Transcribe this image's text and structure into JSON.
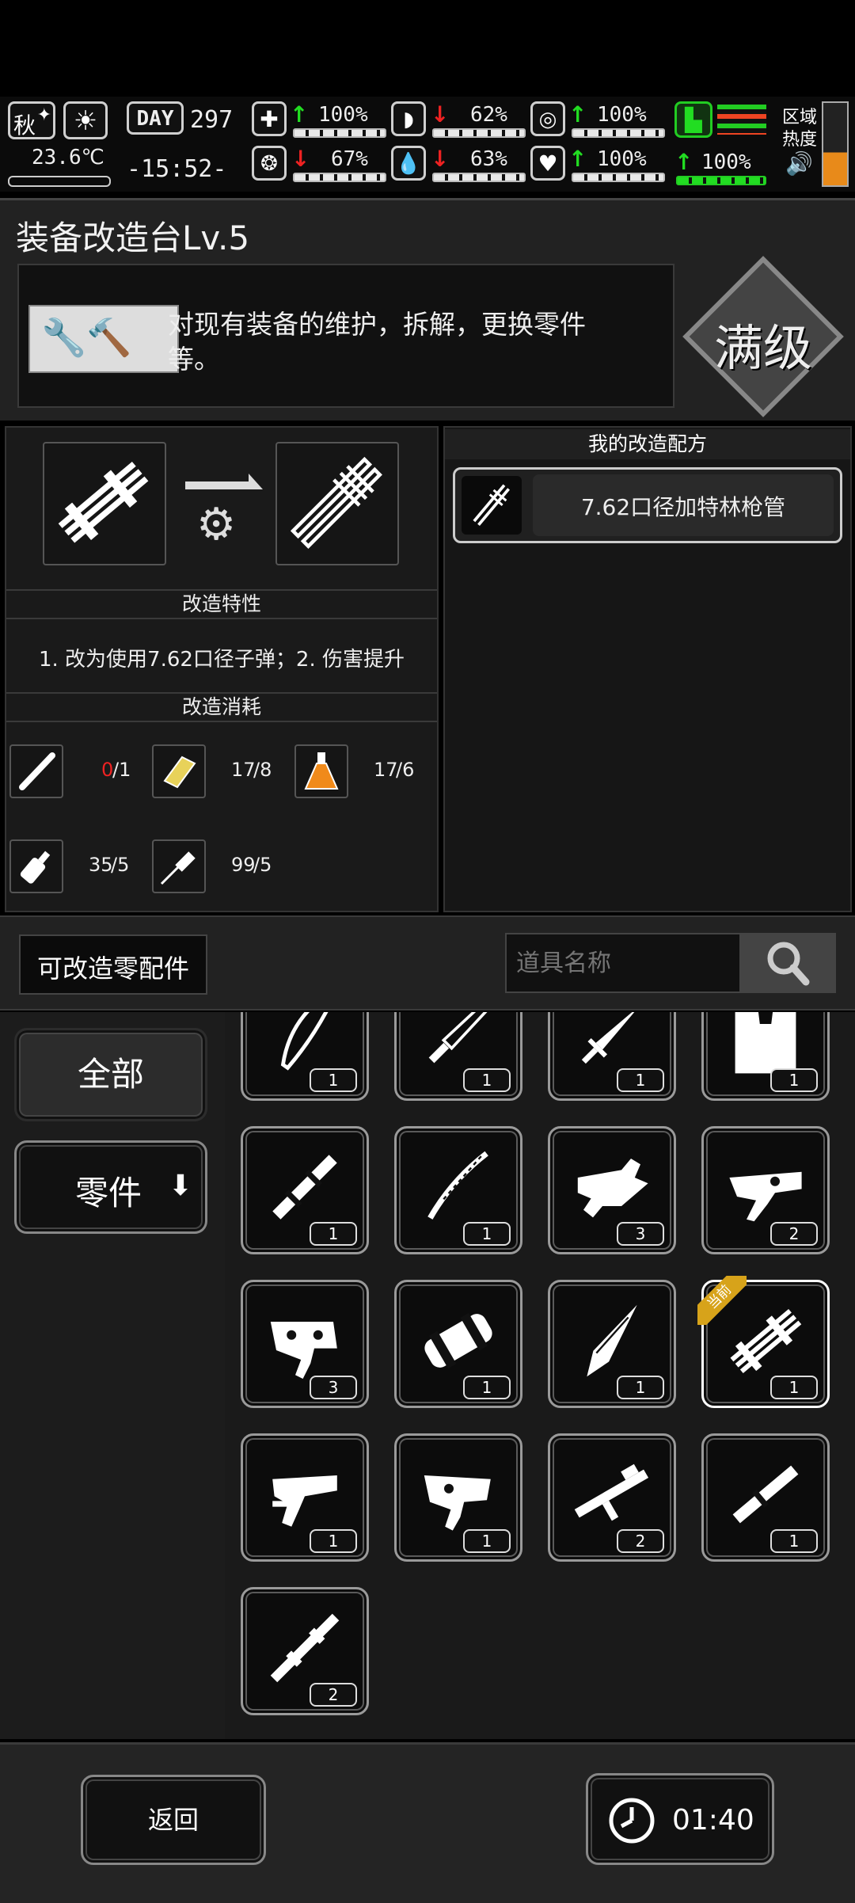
{
  "hud": {
    "season": "秋",
    "temperature": "23.6℃",
    "day_label": "DAY",
    "day_number": "297",
    "clock": "-15:52-",
    "stats": [
      {
        "id": "health",
        "dir": "up",
        "value": "100%"
      },
      {
        "id": "hunger",
        "dir": "down",
        "value": "62%"
      },
      {
        "id": "armor",
        "dir": "up",
        "value": "100%"
      },
      {
        "id": "sanity",
        "dir": "down",
        "value": "67%"
      },
      {
        "id": "thirst",
        "dir": "down",
        "value": "63%"
      },
      {
        "id": "heart",
        "dir": "up",
        "value": "100%"
      },
      {
        "id": "stamina",
        "dir": "up",
        "value": "100%"
      }
    ],
    "zone_heat_label_1": "区域",
    "zone_heat_label_2": "热度"
  },
  "station": {
    "title": "装备改造台Lv.5",
    "description_line1": "对现有装备的维护，拆解，更换零件",
    "description_line2": "等。",
    "max_level_badge": "满级"
  },
  "modify": {
    "traits_header": "改造特性",
    "traits_text": "1. 改为使用7.62口径子弹；2. 伤害提升",
    "cost_header": "改造消耗",
    "costs": [
      {
        "icon": "pipe-icon",
        "have": "0",
        "need": "/1",
        "short": true
      },
      {
        "icon": "gold-bar-icon",
        "have": "17",
        "need": "/8",
        "short": false
      },
      {
        "icon": "potion-flask-icon",
        "have": "17",
        "need": "/6",
        "short": false
      },
      {
        "icon": "oil-can-icon",
        "have": "35",
        "need": "/5",
        "short": false
      },
      {
        "icon": "screwdriver-icon",
        "have": "99",
        "need": "/5",
        "short": false
      }
    ]
  },
  "recipes": {
    "header": "我的改造配方",
    "items": [
      {
        "label": "7.62口径加特林枪管"
      }
    ]
  },
  "parts_bar": {
    "title": "可改造零配件",
    "search_placeholder": "道具名称"
  },
  "categories": [
    {
      "label": "全部"
    },
    {
      "label": "零件"
    }
  ],
  "current_tag": "当前",
  "grid": [
    {
      "icon": "machete-icon",
      "count": "1"
    },
    {
      "icon": "combat-knife-icon",
      "count": "1"
    },
    {
      "icon": "sword-icon",
      "count": "1"
    },
    {
      "icon": "vest-icon",
      "count": "1"
    },
    {
      "icon": "barrel-icon",
      "count": "1"
    },
    {
      "icon": "katana-icon",
      "count": "1"
    },
    {
      "icon": "receiver-icon",
      "count": "3"
    },
    {
      "icon": "trigger-group-icon",
      "count": "2"
    },
    {
      "icon": "trigger-assembly-icon",
      "count": "3"
    },
    {
      "icon": "scope-mount-icon",
      "count": "1"
    },
    {
      "icon": "drill-bit-icon",
      "count": "1"
    },
    {
      "icon": "gatling-barrel-icon",
      "count": "1",
      "current": true
    },
    {
      "icon": "pistol-frame-icon",
      "count": "1"
    },
    {
      "icon": "lower-receiver-icon",
      "count": "1"
    },
    {
      "icon": "rifle-stock-icon",
      "count": "2"
    },
    {
      "icon": "short-barrel-icon",
      "count": "1"
    },
    {
      "icon": "long-barrel-icon",
      "count": "2"
    }
  ],
  "footer": {
    "back_label": "返回",
    "timer": "01:40"
  }
}
